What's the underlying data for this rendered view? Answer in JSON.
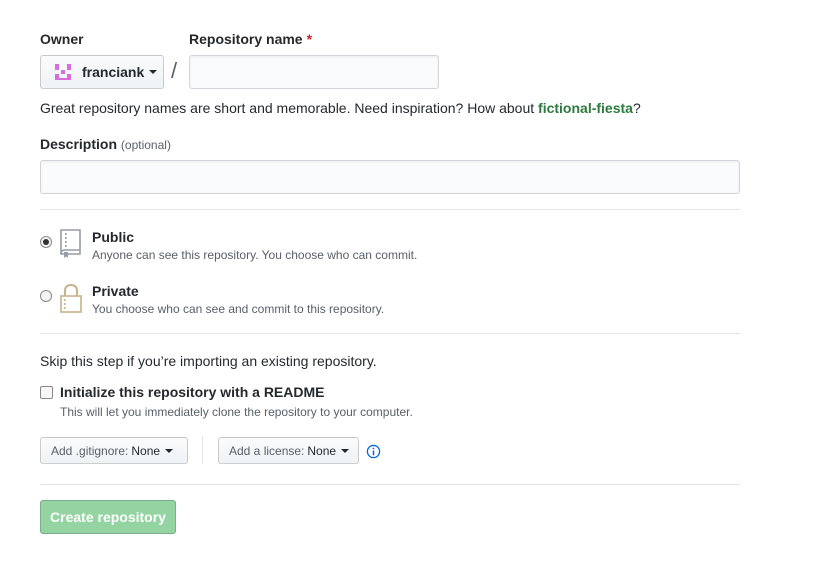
{
  "owner": {
    "label": "Owner",
    "selected": "franciank",
    "avatar_color": "#d86cdc"
  },
  "repo_name": {
    "label": "Repository name",
    "required_marker": "*",
    "value": "",
    "separator": "/"
  },
  "hint": {
    "text": "Great repository names are short and memorable. Need inspiration? How about ",
    "suggestion": "fictional-fiesta",
    "end": "?"
  },
  "description": {
    "label": "Description",
    "optional": "(optional)",
    "value": ""
  },
  "visibility": {
    "selected": "public",
    "public": {
      "title": "Public",
      "note": "Anyone can see this repository. You choose who can commit.",
      "icon": "repo-book-icon"
    },
    "private": {
      "title": "Private",
      "note": "You choose who can see and commit to this repository.",
      "icon": "lock-icon"
    }
  },
  "init": {
    "skip_text": "Skip this step if you’re importing an existing repository.",
    "readme_label": "Initialize this repository with a README",
    "readme_note": "This will let you immediately clone the repository to your computer.",
    "readme_checked": false
  },
  "dropdowns": {
    "gitignore_prefix": "Add .gitignore:",
    "gitignore_value": "None",
    "license_prefix": "Add a license:",
    "license_value": "None",
    "info_icon": "info-icon"
  },
  "submit": {
    "label": "Create repository",
    "color": "#94d3a2",
    "disabled": true
  }
}
